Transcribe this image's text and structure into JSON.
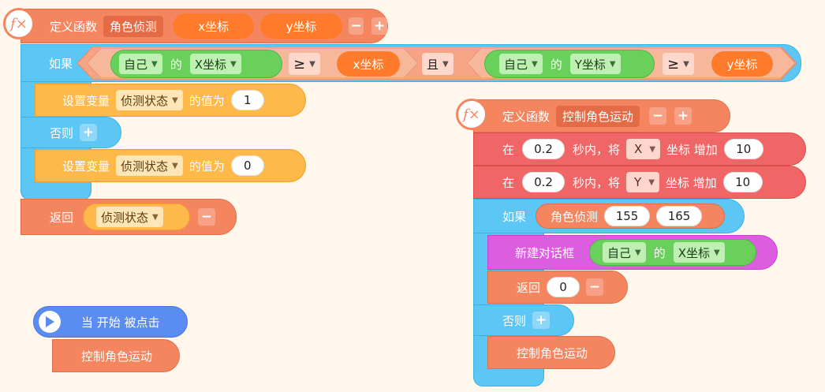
{
  "def1": {
    "keyword": "定义函数",
    "name": "角色侦测",
    "param1": "x坐标",
    "param2": "y坐标",
    "minus": "−",
    "plus": "+"
  },
  "if1": {
    "keyword": "如果",
    "left": {
      "obj": "自己",
      "of": "的",
      "prop": "X坐标",
      "op": "≥",
      "var": "x坐标"
    },
    "and": "且",
    "right": {
      "obj": "自己",
      "of": "的",
      "prop": "Y坐标",
      "op": "≥",
      "var": "y坐标"
    }
  },
  "set1": {
    "keyword": "设置变量",
    "var": "侦测状态",
    "suffix": "的值为",
    "value": "1"
  },
  "else1": {
    "keyword": "否则",
    "plus": "+"
  },
  "set2": {
    "keyword": "设置变量",
    "var": "侦测状态",
    "suffix": "的值为",
    "value": "0"
  },
  "ret1": {
    "keyword": "返回",
    "var": "侦测状态",
    "minus": "−"
  },
  "hat": {
    "label": "当 开始 被点击"
  },
  "call1": {
    "label": "控制角色运动"
  },
  "def2": {
    "keyword": "定义函数",
    "name": "控制角色运动",
    "minus": "−",
    "plus": "+"
  },
  "move1": {
    "prefix": "在",
    "time": "0.2",
    "mid": "秒内，将",
    "axis": "X",
    "suffix": "坐标 增加",
    "amount": "10"
  },
  "move2": {
    "prefix": "在",
    "time": "0.2",
    "mid": "秒内，将",
    "axis": "Y",
    "suffix": "坐标 增加",
    "amount": "10"
  },
  "if2": {
    "keyword": "如果",
    "func": "角色侦测",
    "arg1": "155",
    "arg2": "165"
  },
  "dialog": {
    "keyword": "新建对话框",
    "obj": "自己",
    "of": "的",
    "prop": "X坐标"
  },
  "ret2": {
    "keyword": "返回",
    "value": "0",
    "minus": "−"
  },
  "else2": {
    "keyword": "否则",
    "plus": "+"
  },
  "call2": {
    "label": "控制角色运动"
  },
  "icons": {
    "fx": "fx-function-icon",
    "play": "play-icon",
    "chev": "chevron-down-icon"
  }
}
